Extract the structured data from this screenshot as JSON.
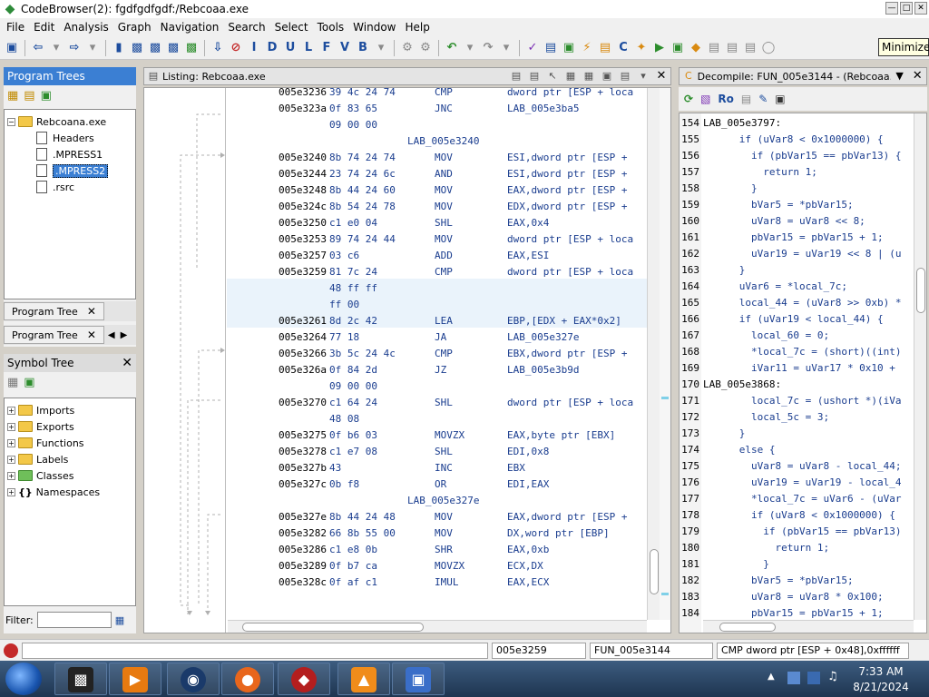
{
  "window": {
    "title": "CodeBrowser(2): fgdfgdfgdf:/Rebcoaa.exe"
  },
  "menu": [
    "File",
    "Edit",
    "Analysis",
    "Graph",
    "Navigation",
    "Search",
    "Select",
    "Tools",
    "Window",
    "Help"
  ],
  "toolbar_letters": [
    "I",
    "D",
    "U",
    "L",
    "F",
    "V",
    "B"
  ],
  "tooltip": "Minimize",
  "program_trees": {
    "title": "Program Trees",
    "root": "Rebcoana.exe",
    "children": [
      "Headers",
      ".MPRESS1",
      ".MPRESS2",
      ".rsrc"
    ],
    "selected": ".MPRESS2",
    "tab_label": "Program Tree",
    "tab_label2": "Program Tree"
  },
  "symbol_tree": {
    "title": "Symbol Tree",
    "items": [
      "Imports",
      "Exports",
      "Functions",
      "Labels",
      "Classes",
      "Namespaces"
    ],
    "filter_label": "Filter:"
  },
  "listing": {
    "title": "Listing:  Rebcoaa.exe",
    "lines": [
      {
        "addr": "005e3236",
        "bytes": "39 4c 24 74",
        "mnem": "CMP",
        "ops": "dword ptr [ESP + loca"
      },
      {
        "addr": "005e323a",
        "bytes": "0f 83 65",
        "mnem": "JNC",
        "ops": "LAB_005e3ba5"
      },
      {
        "addr": "",
        "bytes": "09 00 00",
        "mnem": "",
        "ops": ""
      },
      {
        "label": "LAB_005e3240"
      },
      {
        "addr": "005e3240",
        "bytes": "8b 74 24 74",
        "mnem": "MOV",
        "ops": "ESI,dword ptr [ESP +"
      },
      {
        "addr": "005e3244",
        "bytes": "23 74 24 6c",
        "mnem": "AND",
        "ops": "ESI,dword ptr [ESP +"
      },
      {
        "addr": "005e3248",
        "bytes": "8b 44 24 60",
        "mnem": "MOV",
        "ops": "EAX,dword ptr [ESP +"
      },
      {
        "addr": "005e324c",
        "bytes": "8b 54 24 78",
        "mnem": "MOV",
        "ops": "EDX,dword ptr [ESP +"
      },
      {
        "addr": "005e3250",
        "bytes": "c1 e0 04",
        "mnem": "SHL",
        "ops": "EAX,0x4"
      },
      {
        "addr": "005e3253",
        "bytes": "89 74 24 44",
        "mnem": "MOV",
        "ops": "dword ptr [ESP + loca"
      },
      {
        "addr": "005e3257",
        "bytes": "03 c6",
        "mnem": "ADD",
        "ops": "EAX,ESI"
      },
      {
        "addr": "005e3259",
        "bytes": "81 7c 24",
        "mnem": "CMP",
        "ops": "dword ptr [ESP + loca"
      },
      {
        "addr": "",
        "bytes": "48 ff ff",
        "mnem": "",
        "ops": ""
      },
      {
        "addr": "",
        "bytes": "ff 00",
        "mnem": "",
        "ops": ""
      },
      {
        "addr": "005e3261",
        "bytes": "8d 2c 42",
        "mnem": "LEA",
        "ops": "EBP,[EDX + EAX*0x2]"
      },
      {
        "addr": "005e3264",
        "bytes": "77 18",
        "mnem": "JA",
        "ops": "LAB_005e327e"
      },
      {
        "addr": "005e3266",
        "bytes": "3b 5c 24 4c",
        "mnem": "CMP",
        "ops": "EBX,dword ptr [ESP +"
      },
      {
        "addr": "005e326a",
        "bytes": "0f 84 2d",
        "mnem": "JZ",
        "ops": "LAB_005e3b9d"
      },
      {
        "addr": "",
        "bytes": "09 00 00",
        "mnem": "",
        "ops": ""
      },
      {
        "addr": "005e3270",
        "bytes": "c1 64 24",
        "mnem": "SHL",
        "ops": "dword ptr [ESP + loca"
      },
      {
        "addr": "",
        "bytes": "48 08",
        "mnem": "",
        "ops": ""
      },
      {
        "addr": "005e3275",
        "bytes": "0f b6 03",
        "mnem": "MOVZX",
        "ops": "EAX,byte ptr [EBX]"
      },
      {
        "addr": "005e3278",
        "bytes": "c1 e7 08",
        "mnem": "SHL",
        "ops": "EDI,0x8"
      },
      {
        "addr": "005e327b",
        "bytes": "43",
        "mnem": "INC",
        "ops": "EBX"
      },
      {
        "addr": "005e327c",
        "bytes": "0b f8",
        "mnem": "OR",
        "ops": "EDI,EAX"
      },
      {
        "label": "LAB_005e327e"
      },
      {
        "addr": "005e327e",
        "bytes": "8b 44 24 48",
        "mnem": "MOV",
        "ops": "EAX,dword ptr [ESP +"
      },
      {
        "addr": "005e3282",
        "bytes": "66 8b 55 00",
        "mnem": "MOV",
        "ops": "DX,word ptr [EBP]"
      },
      {
        "addr": "005e3286",
        "bytes": "c1 e8 0b",
        "mnem": "SHR",
        "ops": "EAX,0xb"
      },
      {
        "addr": "005e3289",
        "bytes": "0f b7 ca",
        "mnem": "MOVZX",
        "ops": "ECX,DX"
      },
      {
        "addr": "005e328c",
        "bytes": "0f af c1",
        "mnem": "IMUL",
        "ops": "EAX,ECX"
      }
    ]
  },
  "decompiler": {
    "title": "Decompile: FUN_005e3144 - (Rebcoaa....",
    "lines": [
      {
        "n": "154",
        "code": "LAB_005e3797:",
        "label": true
      },
      {
        "n": "155",
        "code": "      if (uVar8 < 0x1000000) {"
      },
      {
        "n": "156",
        "code": "        if (pbVar15 == pbVar13) {"
      },
      {
        "n": "157",
        "code": "          return 1;"
      },
      {
        "n": "158",
        "code": "        }"
      },
      {
        "n": "159",
        "code": "        bVar5 = *pbVar15;"
      },
      {
        "n": "160",
        "code": "        uVar8 = uVar8 << 8;"
      },
      {
        "n": "161",
        "code": "        pbVar15 = pbVar15 + 1;"
      },
      {
        "n": "162",
        "code": "        uVar19 = uVar19 << 8 | (u"
      },
      {
        "n": "163",
        "code": "      }"
      },
      {
        "n": "164",
        "code": "      uVar6 = *local_7c;"
      },
      {
        "n": "165",
        "code": "      local_44 = (uVar8 >> 0xb) *"
      },
      {
        "n": "166",
        "code": "      if (uVar19 < local_44) {"
      },
      {
        "n": "167",
        "code": "        local_60 = 0;"
      },
      {
        "n": "168",
        "code": "        *local_7c = (short)((int)"
      },
      {
        "n": "169",
        "code": "        iVar11 = uVar17 * 0x10 +"
      },
      {
        "n": "170",
        "code": "LAB_005e3868:",
        "label": true
      },
      {
        "n": "171",
        "code": "        local_7c = (ushort *)(iVa"
      },
      {
        "n": "172",
        "code": "        local_5c = 3;"
      },
      {
        "n": "173",
        "code": "      }"
      },
      {
        "n": "174",
        "code": "      else {"
      },
      {
        "n": "175",
        "code": "        uVar8 = uVar8 - local_44;"
      },
      {
        "n": "176",
        "code": "        uVar19 = uVar19 - local_4"
      },
      {
        "n": "177",
        "code": "        *local_7c = uVar6 - (uVar"
      },
      {
        "n": "178",
        "code": "        if (uVar8 < 0x1000000) {"
      },
      {
        "n": "179",
        "code": "          if (pbVar15 == pbVar13)"
      },
      {
        "n": "180",
        "code": "            return 1;"
      },
      {
        "n": "181",
        "code": "          }"
      },
      {
        "n": "182",
        "code": "        bVar5 = *pbVar15;"
      },
      {
        "n": "183",
        "code": "        uVar8 = uVar8 * 0x100;"
      },
      {
        "n": "184",
        "code": "        pbVar15 = pbVar15 + 1;"
      }
    ]
  },
  "status": {
    "address": "005e3259",
    "function": "FUN_005e3144",
    "instruction": "CMP dword ptr [ESP + 0x48],0xffffff"
  },
  "clock": {
    "time": "7:33 AM",
    "date": "8/21/2024"
  }
}
